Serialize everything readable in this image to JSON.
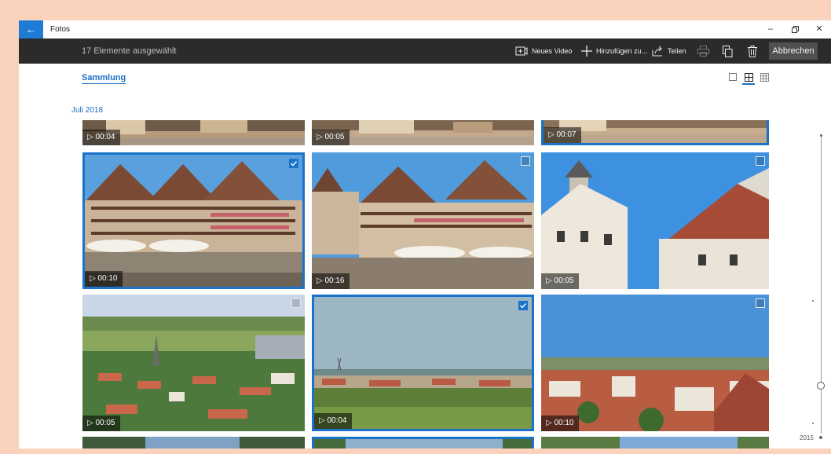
{
  "titlebar": {
    "back_icon": "back-arrow-icon",
    "app_title": "Fotos",
    "controls": [
      "minimize-icon",
      "restore-icon",
      "close-icon"
    ]
  },
  "commandbar": {
    "selection_text": "17 Elemente ausgewählt",
    "new_video": {
      "label": "Neues Video",
      "icon": "video-add-icon"
    },
    "add_to": {
      "label": "Hinzufügen zu...",
      "icon": "plus-icon"
    },
    "share": {
      "label": "Teilen",
      "icon": "share-icon"
    },
    "print_icon": "print-icon",
    "copy_icon": "copy-icon",
    "delete_icon": "trash-icon",
    "cancel_label": "Abbrechen"
  },
  "content": {
    "breadcrumb": "Sammlung",
    "view_sizes": [
      "large",
      "medium",
      "small"
    ],
    "active_view": "medium",
    "month": "Juli 2018"
  },
  "tiles": [
    {
      "duration": "00:04",
      "selected": false,
      "scene": "street"
    },
    {
      "duration": "00:05",
      "selected": false,
      "scene": "street"
    },
    {
      "duration": "00:07",
      "selected": true,
      "scene": "street"
    },
    {
      "duration": "00:10",
      "selected": true,
      "scene": "houses-a"
    },
    {
      "duration": "00:16",
      "selected": false,
      "scene": "houses-b"
    },
    {
      "duration": "00:05",
      "selected": false,
      "scene": "church"
    },
    {
      "duration": "00:05",
      "selected": false,
      "scene": "valley"
    },
    {
      "duration": "00:04",
      "selected": true,
      "scene": "plain"
    },
    {
      "duration": "00:10",
      "selected": false,
      "scene": "roofs"
    }
  ],
  "timeline": {
    "year_label": "2015"
  },
  "colors": {
    "accent": "#1b72c9",
    "commandbar": "#2b2b2b",
    "backdrop": "#fbd3bd"
  }
}
